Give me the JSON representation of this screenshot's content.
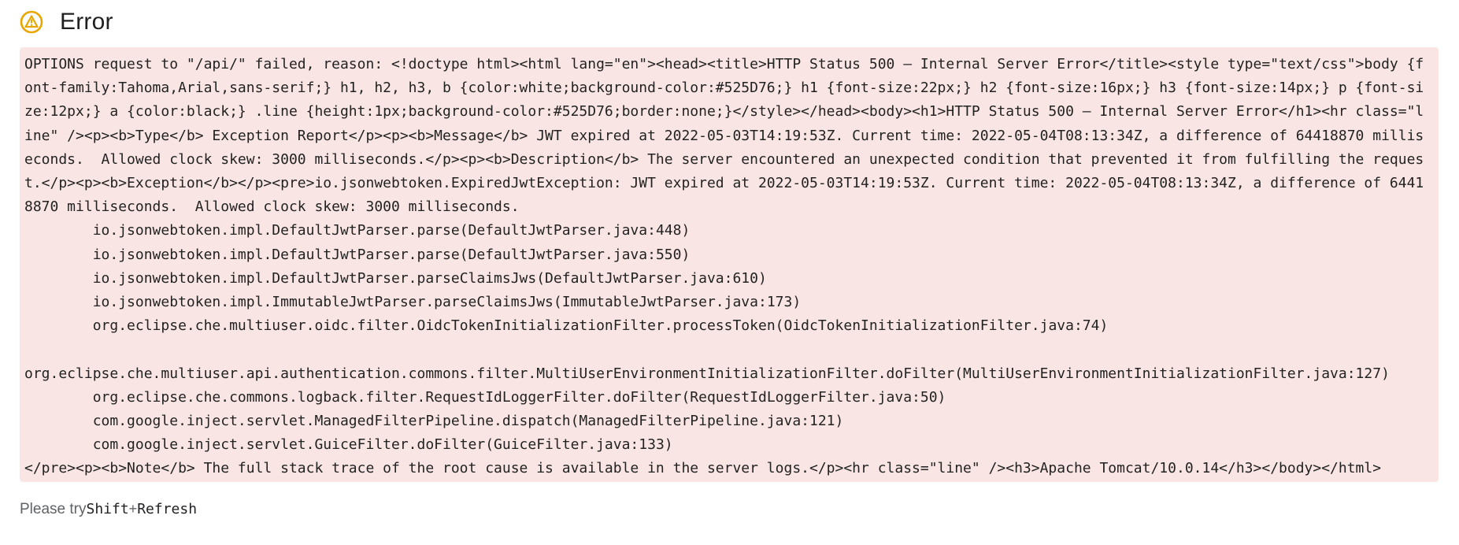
{
  "header": {
    "icon": "warning-icon",
    "title": "Error",
    "accent_color": "#e8a600"
  },
  "error": {
    "background": "#f9e6e4",
    "message": "OPTIONS request to \"/api/\" failed, reason: <!doctype html><html lang=\"en\"><head><title>HTTP Status 500 – Internal Server Error</title><style type=\"text/css\">body {font-family:Tahoma,Arial,sans-serif;} h1, h2, h3, b {color:white;background-color:#525D76;} h1 {font-size:22px;} h2 {font-size:16px;} h3 {font-size:14px;} p {font-size:12px;} a {color:black;} .line {height:1px;background-color:#525D76;border:none;}</style></head><body><h1>HTTP Status 500 – Internal Server Error</h1><hr class=\"line\" /><p><b>Type</b> Exception Report</p><p><b>Message</b> JWT expired at 2022-05-03T14:19:53Z. Current time: 2022-05-04T08:13:34Z, a difference of 64418870 milliseconds.  Allowed clock skew: 3000 milliseconds.</p><p><b>Description</b> The server encountered an unexpected condition that prevented it from fulfilling the request.</p><p><b>Exception</b></p><pre>io.jsonwebtoken.ExpiredJwtException: JWT expired at 2022-05-03T14:19:53Z. Current time: 2022-05-04T08:13:34Z, a difference of 64418870 milliseconds.  Allowed clock skew: 3000 milliseconds.\n\tio.jsonwebtoken.impl.DefaultJwtParser.parse(DefaultJwtParser.java:448)\n\tio.jsonwebtoken.impl.DefaultJwtParser.parse(DefaultJwtParser.java:550)\n\tio.jsonwebtoken.impl.DefaultJwtParser.parseClaimsJws(DefaultJwtParser.java:610)\n\tio.jsonwebtoken.impl.ImmutableJwtParser.parseClaimsJws(ImmutableJwtParser.java:173)\n\torg.eclipse.che.multiuser.oidc.filter.OidcTokenInitializationFilter.processToken(OidcTokenInitializationFilter.java:74)\n\norg.eclipse.che.multiuser.api.authentication.commons.filter.MultiUserEnvironmentInitializationFilter.doFilter(MultiUserEnvironmentInitializationFilter.java:127)\n\torg.eclipse.che.commons.logback.filter.RequestIdLoggerFilter.doFilter(RequestIdLoggerFilter.java:50)\n\tcom.google.inject.servlet.ManagedFilterPipeline.dispatch(ManagedFilterPipeline.java:121)\n\tcom.google.inject.servlet.GuiceFilter.doFilter(GuiceFilter.java:133)\n</pre><p><b>Note</b> The full stack trace of the root cause is available in the server logs.</p><hr class=\"line\" /><h3>Apache Tomcat/10.0.14</h3></body></html>"
  },
  "hint": {
    "prefix": "Please try ",
    "key1": "Shift",
    "plus": "+",
    "key2": "Refresh"
  }
}
